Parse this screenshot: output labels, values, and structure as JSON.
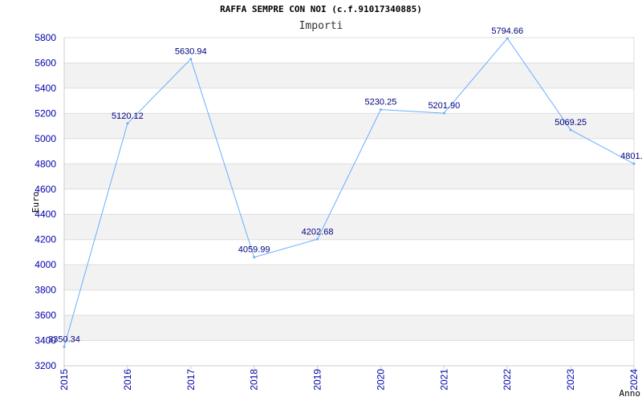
{
  "header": {
    "title": "RAFFA SEMPRE CON NOI (c.f.91017340885)",
    "subtitle": "Importi"
  },
  "chart_data": {
    "type": "line",
    "title": "RAFFA SEMPRE CON NOI (c.f.91017340885)",
    "subtitle": "Importi",
    "xlabel": "Anno",
    "ylabel": "Euro",
    "x": [
      "2015",
      "2016",
      "2017",
      "2018",
      "2019",
      "2020",
      "2021",
      "2022",
      "2023",
      "2024"
    ],
    "series": [
      {
        "values": [
          3350.34,
          5120.12,
          5630.94,
          4059.99,
          4202.68,
          5230.25,
          5201.9,
          5794.66,
          5069.25,
          4801.0
        ],
        "labels": [
          "3350.34",
          "5120.12",
          "5630.94",
          "4059.99",
          "4202.68",
          "5230.25",
          "5201.90",
          "5794.66",
          "5069.25",
          "4801.0"
        ]
      }
    ],
    "ylim": [
      3200,
      5800
    ],
    "yticks": [
      3200,
      3400,
      3600,
      3800,
      4000,
      4200,
      4400,
      4600,
      4800,
      5000,
      5200,
      5400,
      5600,
      5800
    ],
    "grid": true,
    "line_color": "#6aaeff",
    "band_color": "#f2f2f2",
    "gridline_color": "#dddddd",
    "tick_color": "#0000aa",
    "label_color": "#000080"
  }
}
